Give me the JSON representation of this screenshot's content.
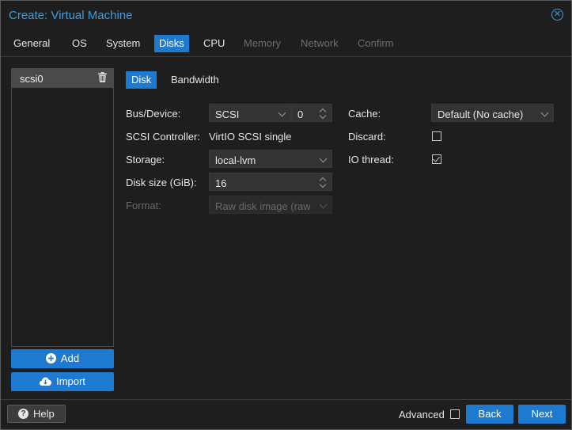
{
  "window": {
    "title": "Create: Virtual Machine"
  },
  "tabs": [
    {
      "label": "General",
      "state": "enabled"
    },
    {
      "label": "OS",
      "state": "enabled"
    },
    {
      "label": "System",
      "state": "enabled"
    },
    {
      "label": "Disks",
      "state": "active"
    },
    {
      "label": "CPU",
      "state": "enabled"
    },
    {
      "label": "Memory",
      "state": "disabled"
    },
    {
      "label": "Network",
      "state": "disabled"
    },
    {
      "label": "Confirm",
      "state": "disabled"
    }
  ],
  "disk_list": {
    "items": [
      {
        "label": "scsi0",
        "icon": "trash-icon"
      }
    ],
    "add_label": "Add",
    "import_label": "Import"
  },
  "inner_tabs": [
    {
      "label": "Disk",
      "active": true
    },
    {
      "label": "Bandwidth",
      "active": false
    }
  ],
  "form": {
    "bus_device_label": "Bus/Device:",
    "bus_value": "SCSI",
    "device_number": "0",
    "scsi_controller_label": "SCSI Controller:",
    "scsi_controller_value": "VirtIO SCSI single",
    "storage_label": "Storage:",
    "storage_value": "local-lvm",
    "disk_size_label": "Disk size (GiB):",
    "disk_size_value": "16",
    "format_label": "Format:",
    "format_value": "Raw disk image (raw)",
    "cache_label": "Cache:",
    "cache_value": "Default (No cache)",
    "discard_label": "Discard:",
    "discard_checked": false,
    "io_thread_label": "IO thread:",
    "io_thread_checked": true
  },
  "footer": {
    "help_label": "Help",
    "advanced_label": "Advanced",
    "advanced_checked": false,
    "back_label": "Back",
    "next_label": "Next"
  },
  "colors": {
    "accent": "#1e7ad0",
    "title": "#3a9fe0",
    "background": "#1e1e1e"
  }
}
